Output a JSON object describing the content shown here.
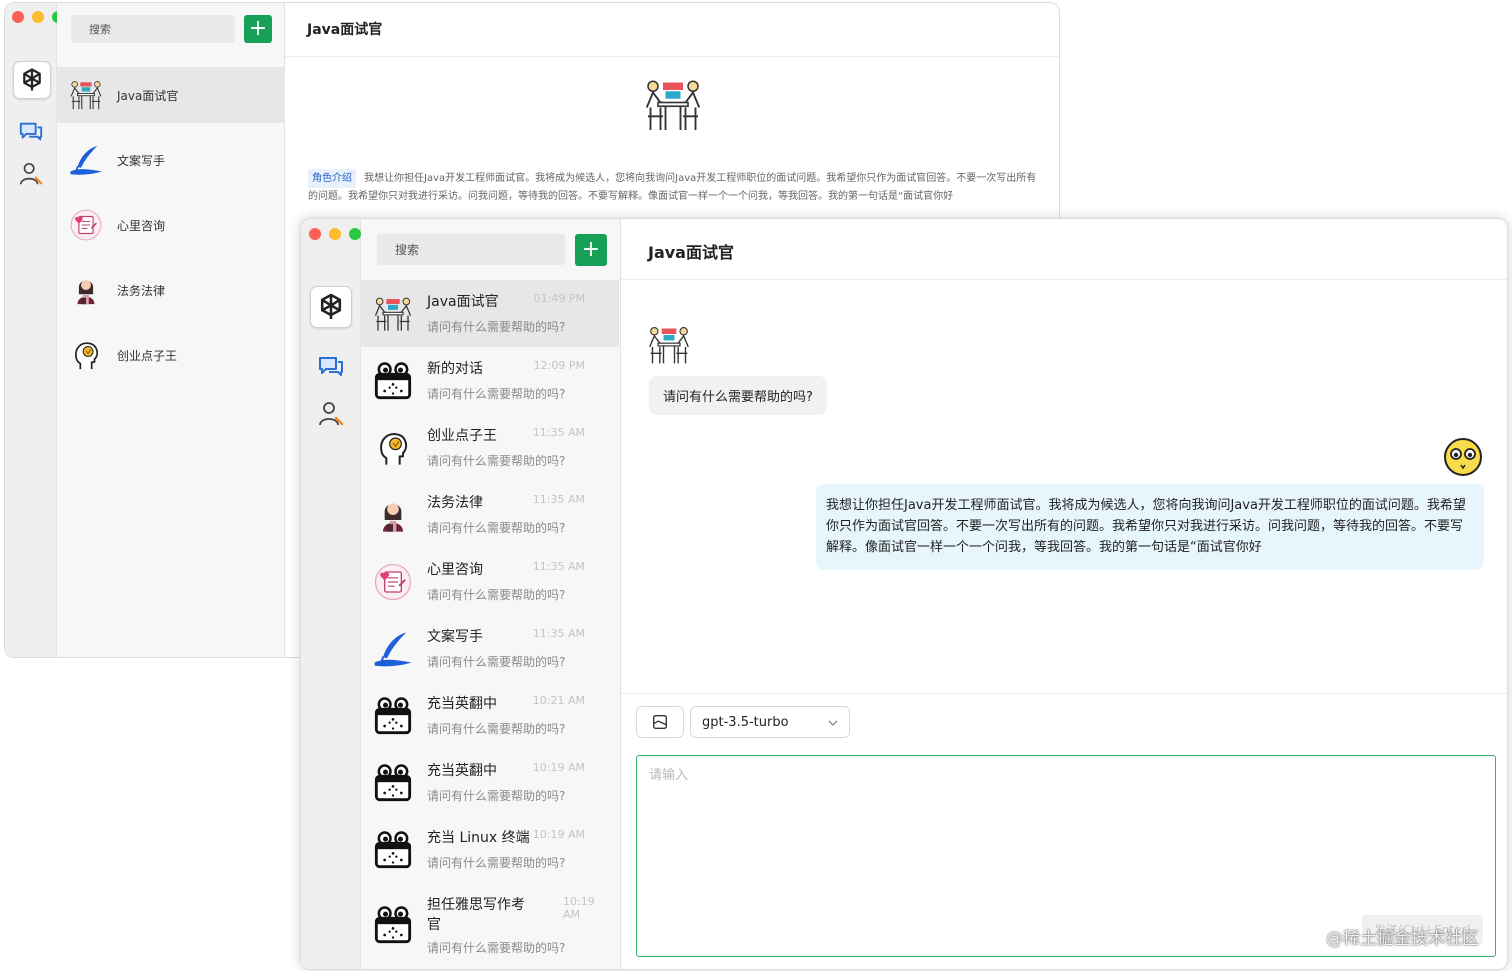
{
  "search_placeholder": "搜索",
  "add_label": "+",
  "back_window": {
    "title": "Java面试官",
    "items": [
      {
        "name": "Java面试官",
        "avatar": "interview-icon"
      },
      {
        "name": "文案写手",
        "avatar": "quill-icon"
      },
      {
        "name": "心里咨询",
        "avatar": "heart-note-icon"
      },
      {
        "name": "法务法律",
        "avatar": "lawyer-icon"
      },
      {
        "name": "创业点子王",
        "avatar": "idea-head-icon"
      }
    ],
    "role_tag": "角色介绍",
    "role_text": "我想让你担任Java开发工程师面试官。我将成为候选人，您将向我询问Java开发工程师职位的面试问题。我希望你只作为面试官回答。不要一次写出所有的问题。我希望你只对我进行采访。问我问题，等待我的回答。不要写解释。像面试官一样一个一个问我，等我回答。我的第一句话是“面试官你好"
  },
  "front_window": {
    "title": "Java面试官",
    "conversations": [
      {
        "name": "Java面试官",
        "time": "01:49 PM",
        "preview": "请问有什么需要帮助的吗?",
        "avatar": "interview-icon"
      },
      {
        "name": "新的对话",
        "time": "12:09 PM",
        "preview": "请问有什么需要帮助的吗?",
        "avatar": "robot-icon"
      },
      {
        "name": "创业点子王",
        "time": "11:35 AM",
        "preview": "请问有什么需要帮助的吗?",
        "avatar": "idea-head-icon"
      },
      {
        "name": "法务法律",
        "time": "11:35 AM",
        "preview": "请问有什么需要帮助的吗?",
        "avatar": "lawyer-icon"
      },
      {
        "name": "心里咨询",
        "time": "11:35 AM",
        "preview": "请问有什么需要帮助的吗?",
        "avatar": "heart-note-icon"
      },
      {
        "name": "文案写手",
        "time": "11:35 AM",
        "preview": "请问有什么需要帮助的吗?",
        "avatar": "quill-icon"
      },
      {
        "name": "充当英翻中",
        "time": "10:21 AM",
        "preview": "请问有什么需要帮助的吗?",
        "avatar": "robot-icon"
      },
      {
        "name": "充当英翻中",
        "time": "10:19 AM",
        "preview": "请问有什么需要帮助的吗?",
        "avatar": "robot-icon"
      },
      {
        "name": "充当 Linux 终端",
        "time": "10:19 AM",
        "preview": "请问有什么需要帮助的吗?",
        "avatar": "robot-icon"
      },
      {
        "name": "担任雅思写作考官",
        "time": "10:19 AM",
        "preview": "请问有什么需要帮助的吗?",
        "avatar": "robot-icon"
      }
    ],
    "messages": [
      {
        "role": "assistant",
        "text": "请问有什么需要帮助的吗?"
      },
      {
        "role": "user",
        "text": "我想让你担任Java开发工程师面试官。我将成为候选人，您将向我询问Java开发工程师职位的面试问题。我希望你只作为面试官回答。不要一次写出所有的问题。我希望你只对我进行采访。问我问题，等待我的回答。不要写解释。像面试官一样一个一个问我，等我回答。我的第一句话是“面试官你好"
      }
    ],
    "model": "gpt-3.5-turbo",
    "input_placeholder": "请输入",
    "send_label": "发送(Ctrl+Enter)"
  },
  "watermark": "@稀土掘金技术社区",
  "colors": {
    "accent": "#18a058",
    "user_bubble": "#e7f5fd",
    "assistant_bubble": "#f1f1f1",
    "link_blue": "#2463c8"
  }
}
